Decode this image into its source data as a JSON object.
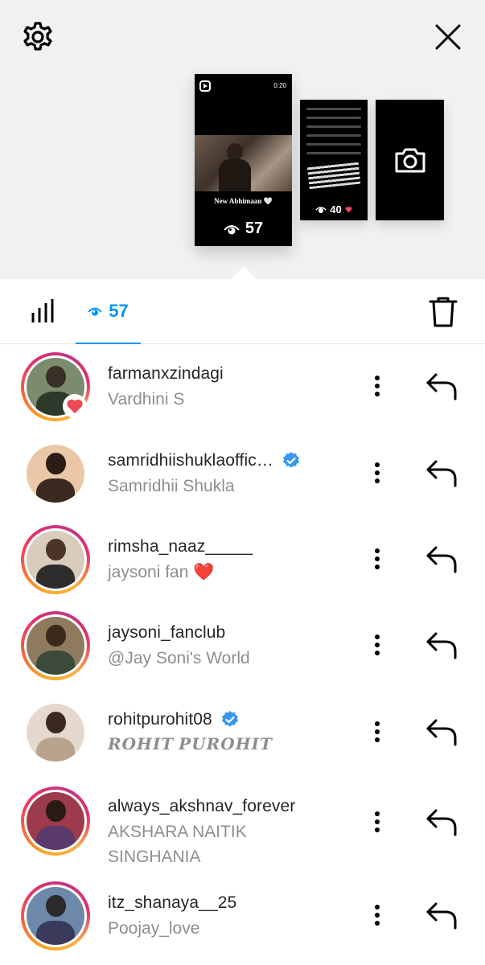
{
  "header": {
    "settings_icon": "gear-icon",
    "close_icon": "close-icon"
  },
  "stories": {
    "main": {
      "caption": "New Abhimaan 🤍",
      "time": "0:20",
      "views": "57"
    },
    "second": {
      "views": "40"
    },
    "camera_icon": "camera-icon"
  },
  "tabs": {
    "insights_icon": "bar-chart-icon",
    "viewers_count": "57",
    "delete_icon": "trash-icon",
    "accent": "#0095f6"
  },
  "viewers": [
    {
      "username": "farmanxzindagi",
      "name": "Vardhini S",
      "verified": false,
      "liked": true,
      "ring": true,
      "sub_style": "normal"
    },
    {
      "username": "samridhiishuklaoffic…",
      "name": "Samridhii Shukla",
      "verified": true,
      "liked": false,
      "ring": false,
      "sub_style": "normal"
    },
    {
      "username": "rimsha_naaz_____",
      "name": "jaysoni fan ❤️",
      "verified": false,
      "liked": false,
      "ring": true,
      "sub_style": "normal"
    },
    {
      "username": "jaysoni_fanclub",
      "name": "@Jay Soni's World",
      "verified": false,
      "liked": false,
      "ring": true,
      "sub_style": "normal"
    },
    {
      "username": "rohitpurohit08",
      "name": "𝑹𝑶𝑯𝑰𝑻 𝑷𝑼𝑹𝑶𝑯𝑰𝑻",
      "verified": true,
      "liked": false,
      "ring": false,
      "sub_style": "serif"
    },
    {
      "username": "always_akshnav_forever",
      "name": "AKSHARA NAITIK",
      "name_line2": "SINGHANIA",
      "verified": false,
      "liked": false,
      "ring": true,
      "sub_style": "normal"
    },
    {
      "username": "itz_shanaya__25",
      "name": "Poojay_love",
      "verified": false,
      "liked": false,
      "ring": true,
      "sub_style": "normal"
    }
  ]
}
